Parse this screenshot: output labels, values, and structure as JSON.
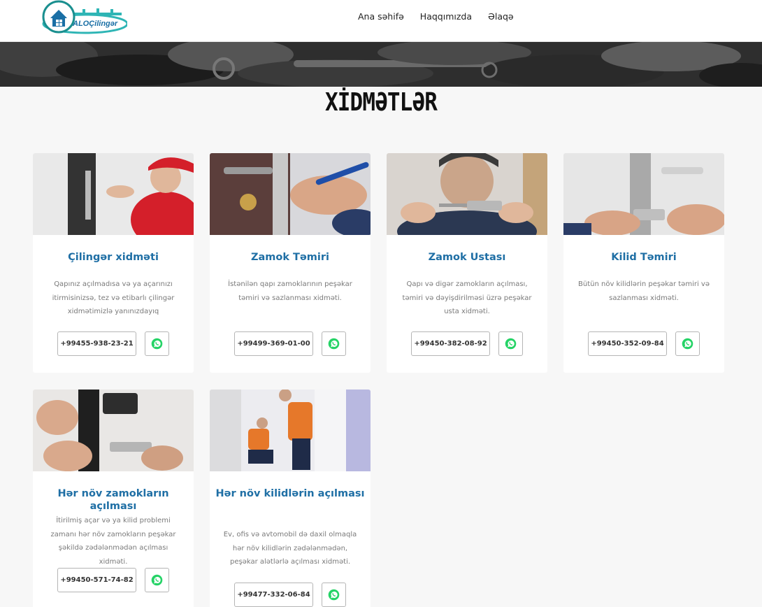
{
  "brand": {
    "logo_text": "ALOÇilingər"
  },
  "nav": [
    {
      "label": "Ana səhifə"
    },
    {
      "label": "Haqqımızda"
    },
    {
      "label": "Əlaqə"
    }
  ],
  "page": {
    "title": "XİDMƏTLƏR"
  },
  "services": [
    {
      "title": "Çilingər xidməti",
      "desc": "Qapınız açılmadısa və ya açarınızı itirmisinizsə, tez və etibarlı çilingər xidmətimizlə yanınızdayıq",
      "phone": "+99455-938-23-21"
    },
    {
      "title": "Zamok Təmiri",
      "desc": "İstənilən qapı zamoklarının peşəkar təmiri və sazlanması xidməti.",
      "phone": "+99499-369-01-00"
    },
    {
      "title": "Zamok Ustası",
      "desc": "Qapı və digər zamokların açılması, təmiri və dəyişdirilməsi üzrə peşəkar usta xidməti.",
      "phone": "+99450-382-08-92"
    },
    {
      "title": "Kilid Təmiri",
      "desc": "Bütün növ kilidlərin peşəkar təmiri və sazlanması xidməti.",
      "phone": "+99450-352-09-84"
    },
    {
      "title": "Hər növ zamokların açılması",
      "desc": "İtirilmiş açar və ya kilid problemi zamanı hər növ zamokların peşəkar şəkildə zədələnmədən açılması xidməti.",
      "phone": "+99450-571-74-82"
    },
    {
      "title": "Hər növ kilidlərin açılması",
      "desc": "Ev, ofis və avtomobil də daxil olmaqla hər növ kilidlərin zədələnmədən, peşəkar alətlərlə açılması xidməti.",
      "phone": "+99477-332-06-84"
    }
  ],
  "icons": {
    "whatsapp": "whatsapp-icon"
  },
  "colors": {
    "accent": "#1f6fa5",
    "whatsapp": "#25d366"
  }
}
